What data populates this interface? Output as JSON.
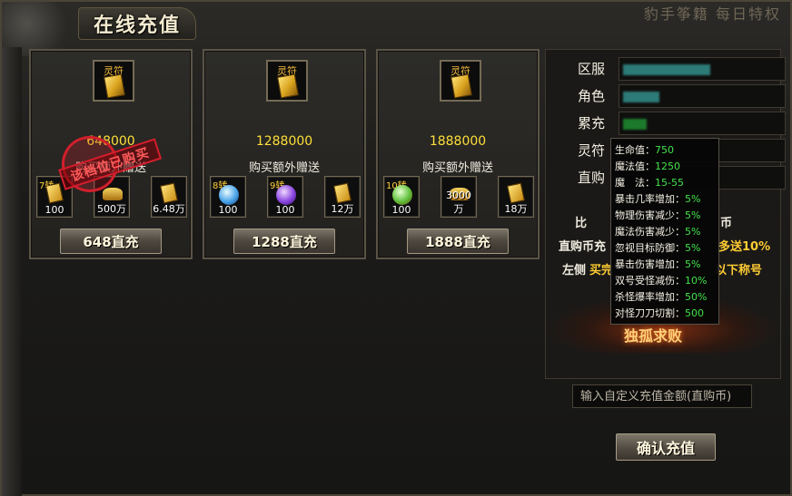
{
  "header": {
    "title": "在线充值",
    "bg_topright_text": "豹手筝籍  每日特权"
  },
  "cards": [
    {
      "icon_label": "灵符",
      "amount": "648000",
      "bonus_label": "购买额外赠送",
      "button": "648直充",
      "slots": [
        {
          "badge": "7转",
          "qty": "100",
          "icon": "gold-item-icon"
        },
        {
          "badge": "",
          "qty": "500万",
          "icon": "gold-ingot-icon"
        },
        {
          "badge": "",
          "qty": "6.48万",
          "icon": "talisman-icon"
        }
      ],
      "stamp": "该档位已购买"
    },
    {
      "icon_label": "灵符",
      "amount": "1288000",
      "bonus_label": "购买额外赠送",
      "button": "1288直充",
      "slots": [
        {
          "badge": "8转",
          "qty": "100",
          "icon": "blue-orb-icon"
        },
        {
          "badge": "9转",
          "qty": "100",
          "icon": "purple-orb-icon"
        },
        {
          "badge": "",
          "qty": "12万",
          "icon": "talisman-icon"
        }
      ]
    },
    {
      "icon_label": "灵符",
      "amount": "1888000",
      "bonus_label": "购买额外赠送",
      "button": "1888直充",
      "slots": [
        {
          "badge": "10转",
          "qty": "100",
          "icon": "green-orb-icon"
        },
        {
          "badge": "",
          "qty": "3000万",
          "icon": "gold-ingot-icon"
        },
        {
          "badge": "",
          "qty": "18万",
          "icon": "talisman-icon"
        }
      ]
    }
  ],
  "info": {
    "server_label": "区服",
    "role_label": "角色",
    "total_label": "累充",
    "talisman_label": "灵符",
    "direct_label": "直购"
  },
  "promo": {
    "line1": "比",
    "line1_tail": "币",
    "line2_head": "直购币充",
    "line2_tail": "多送10%",
    "line3_head": "左侧",
    "line3_mid": "买完",
    "line3_tail": "以下称号"
  },
  "seal_text": "独孤求败",
  "tooltip": [
    {
      "k": "生命值：",
      "v": "750"
    },
    {
      "k": "魔法值：",
      "v": "1250"
    },
    {
      "k": "魔　法：",
      "v": "15-55"
    },
    {
      "k": "暴击几率增加：",
      "v": "5%"
    },
    {
      "k": "物理伤害减少：",
      "v": "5%"
    },
    {
      "k": "魔法伤害减少：",
      "v": "5%"
    },
    {
      "k": "忽视目标防御：",
      "v": "5%"
    },
    {
      "k": "暴击伤害增加：",
      "v": "5%"
    },
    {
      "k": "双号受怪减伤：",
      "v": "10%"
    },
    {
      "k": "杀怪爆率增加：",
      "v": "50%"
    },
    {
      "k": "对怪刀刀切割：",
      "v": "500"
    }
  ],
  "custom": {
    "placeholder": "输入自定义充值金额(直购币)",
    "confirm": "确认充值"
  }
}
